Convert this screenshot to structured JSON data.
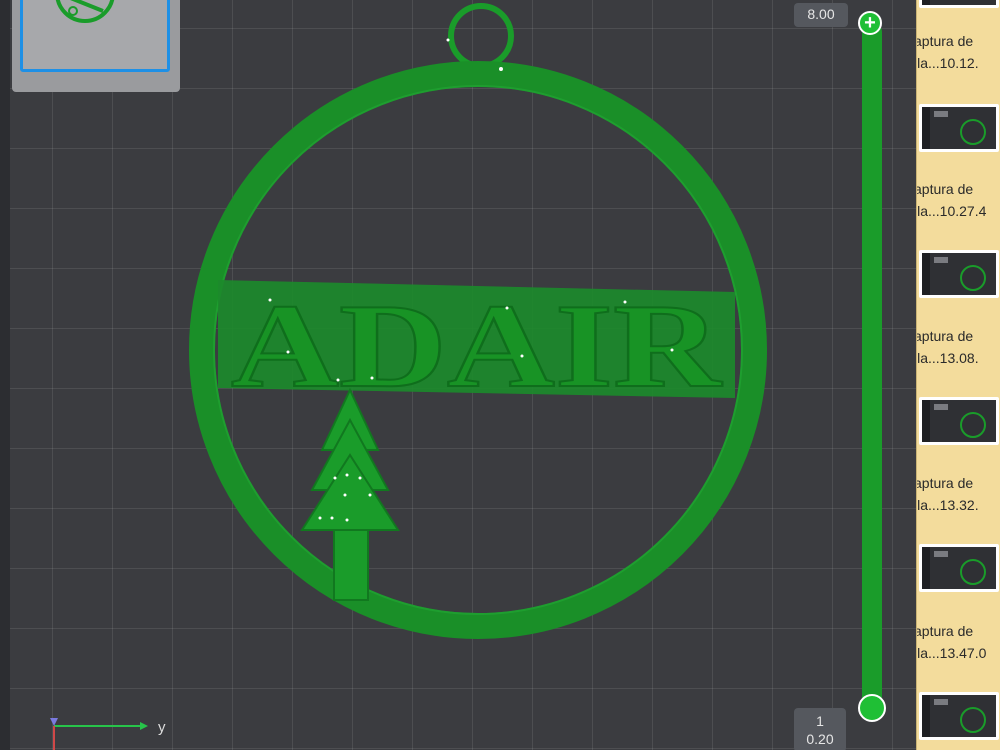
{
  "slider": {
    "top_value": "8.00",
    "bottom_layer": "1",
    "bottom_value": "0.20",
    "plus_symbol": "+"
  },
  "model": {
    "text": "ADAIR"
  },
  "axis": {
    "y_label": "y"
  },
  "desktop": {
    "files": [
      {
        "line1": "aptura de",
        "line2": "lla...10.12."
      },
      {
        "line1": "aptura de",
        "line2": "lla...10.27.4"
      },
      {
        "line1": "aptura de",
        "line2": "lla...13.08."
      },
      {
        "line1": "aptura de",
        "line2": "lla...13.32."
      },
      {
        "line1": "aptura de",
        "line2": "lla...13.47.0"
      }
    ]
  },
  "colors": {
    "filament_green": "#1a9c2a",
    "viewport_bg": "#3b3c40",
    "desktop_bg": "#f3dc9c"
  }
}
